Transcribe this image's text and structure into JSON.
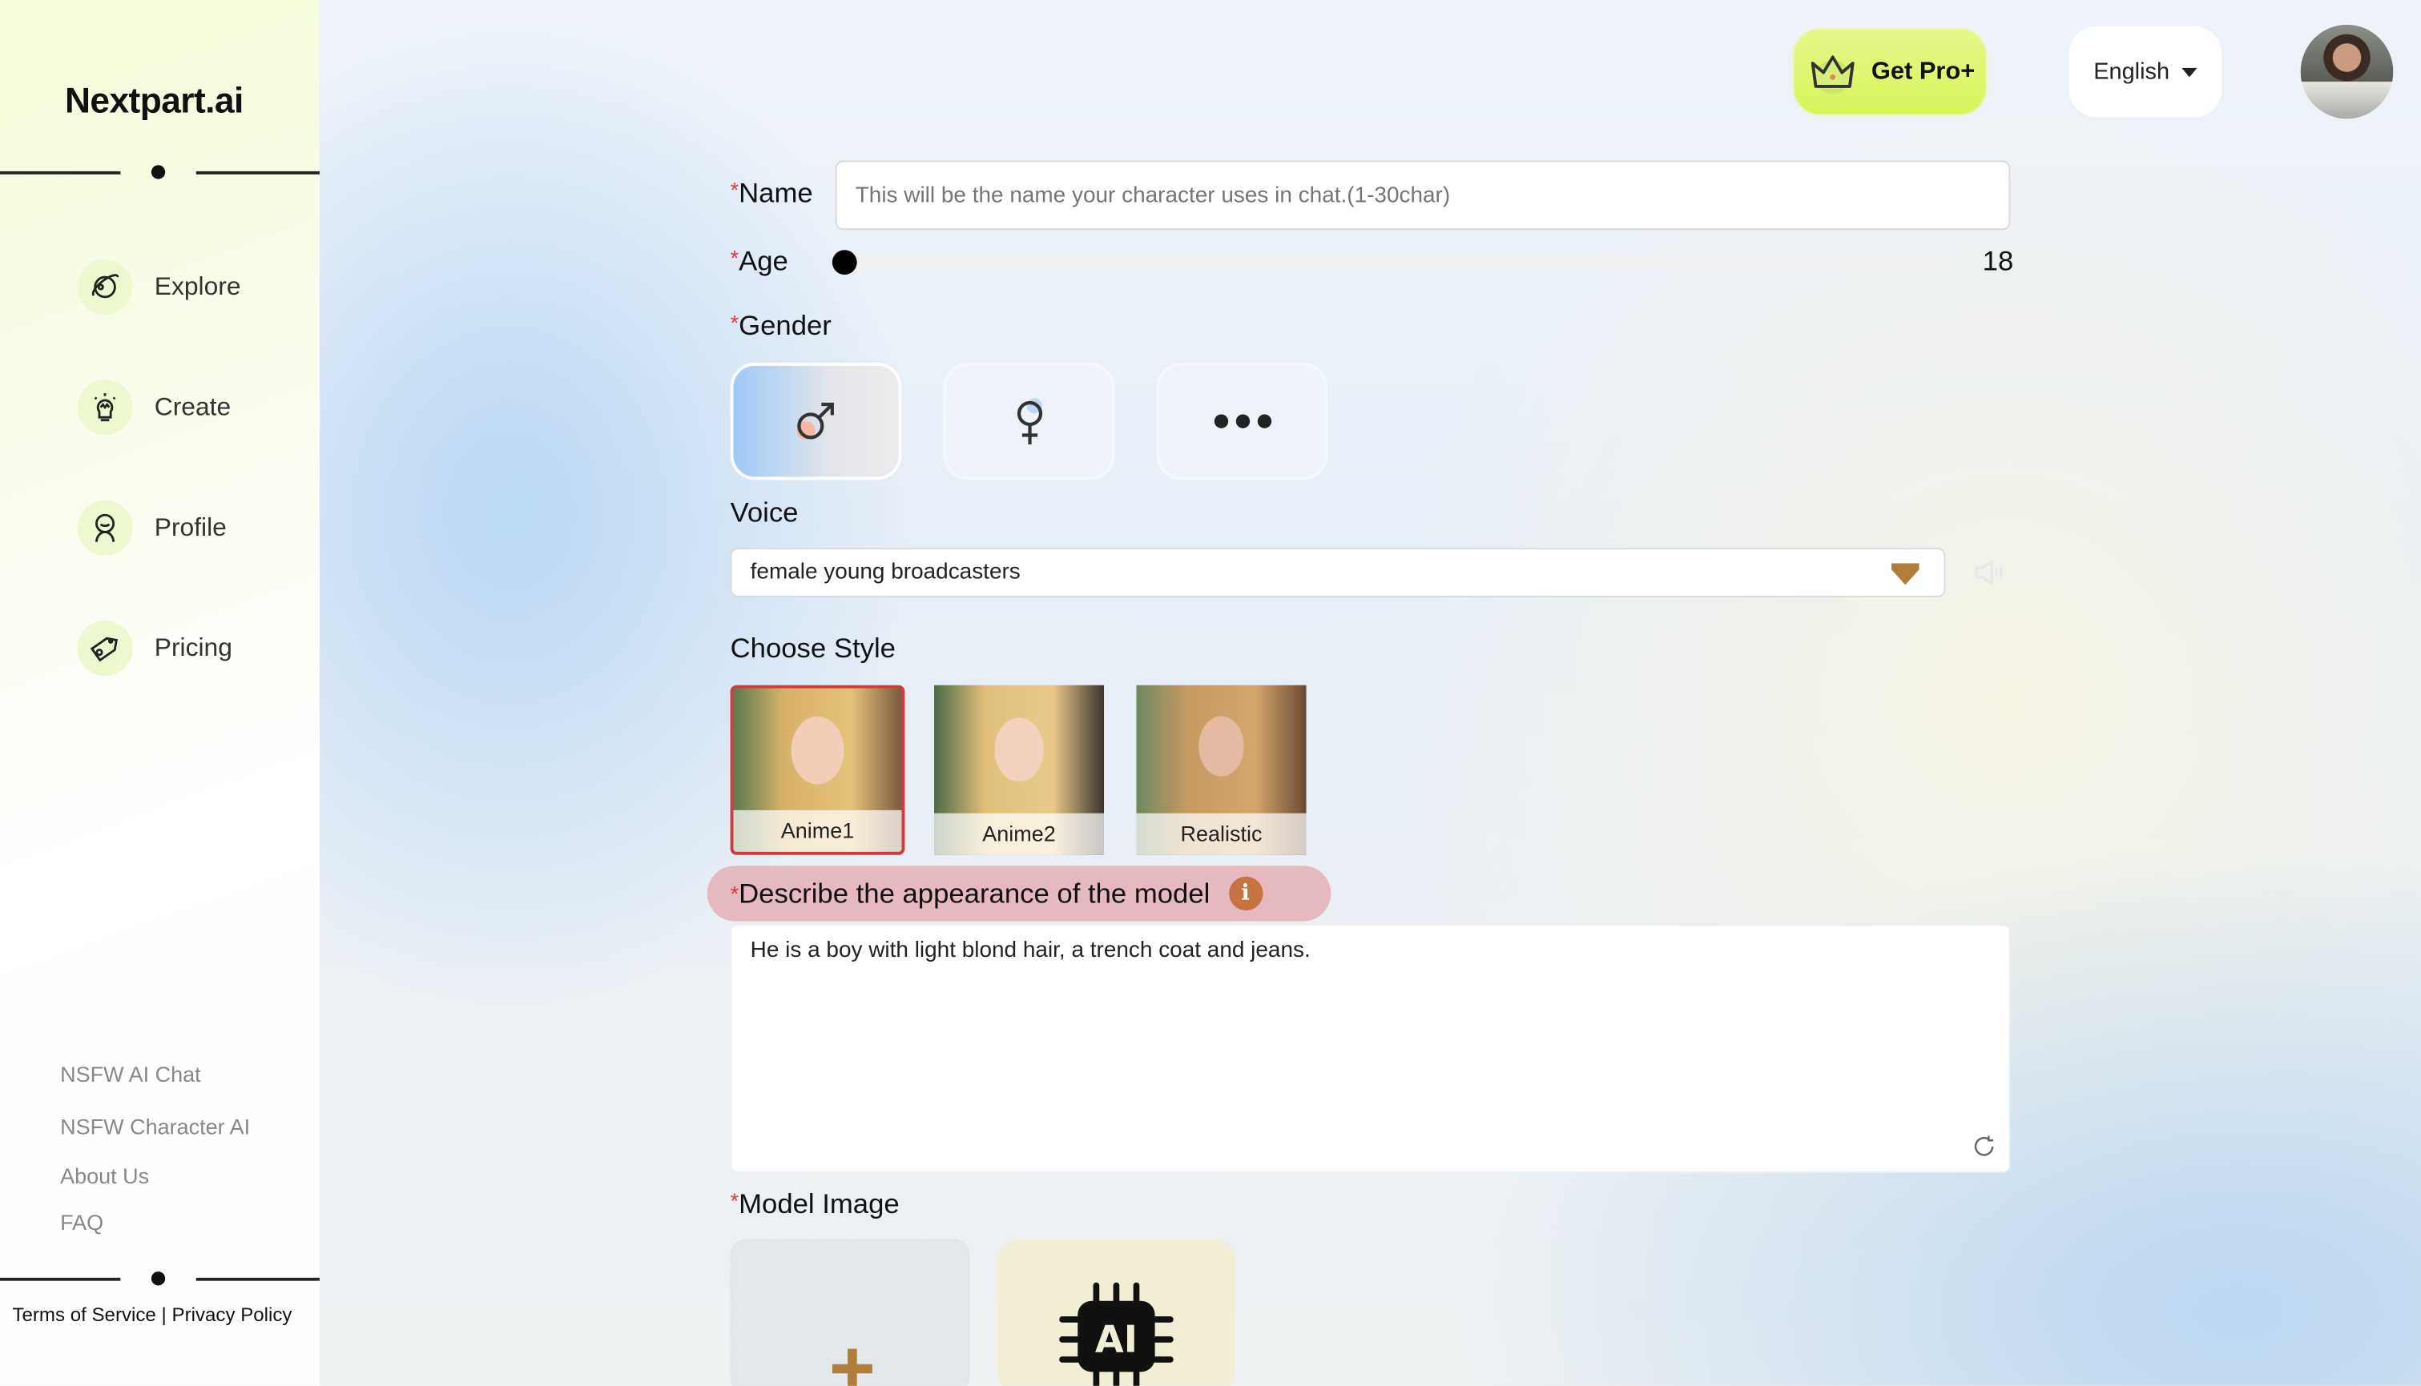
{
  "sidebar": {
    "logo": "Nextpart.ai",
    "nav": [
      {
        "label": "Explore",
        "icon": "planet-icon"
      },
      {
        "label": "Create",
        "icon": "lightbulb-icon"
      },
      {
        "label": "Profile",
        "icon": "person-icon"
      },
      {
        "label": "Pricing",
        "icon": "tag-icon"
      }
    ],
    "footer_links": [
      "NSFW AI Chat",
      "NSFW Character AI",
      "About Us",
      "FAQ"
    ],
    "terms": "Terms of Service",
    "separator": "|",
    "privacy": "Privacy Policy"
  },
  "header": {
    "pro_label": "Get Pro+",
    "language": "English"
  },
  "form": {
    "required_mark": "*",
    "name_label": "Name",
    "name_placeholder": "This will be the name your character uses in chat.(1-30char)",
    "name_value": "",
    "age_label": "Age",
    "age_value": "18",
    "age_min": 18,
    "gender_label": "Gender",
    "gender_options": [
      "male",
      "female",
      "more"
    ],
    "gender_selected": "male",
    "voice_label": "Voice",
    "voice_value": "female young broadcasters",
    "style_label": "Choose Style",
    "styles": [
      "Anime1",
      "Anime2",
      "Realistic"
    ],
    "style_selected": "Anime1",
    "describe_label": "Describe the appearance of the model",
    "describe_value": "He is a boy with light blond hair, a trench coat and jeans.",
    "model_image_label": "Model Image"
  },
  "colors": {
    "accent_required": "#e0393b",
    "pro_button": "#d8f55a",
    "selected_style_border": "#d23b3b",
    "describe_highlight": "#e6b9c0",
    "info_icon": "#c6733f"
  }
}
